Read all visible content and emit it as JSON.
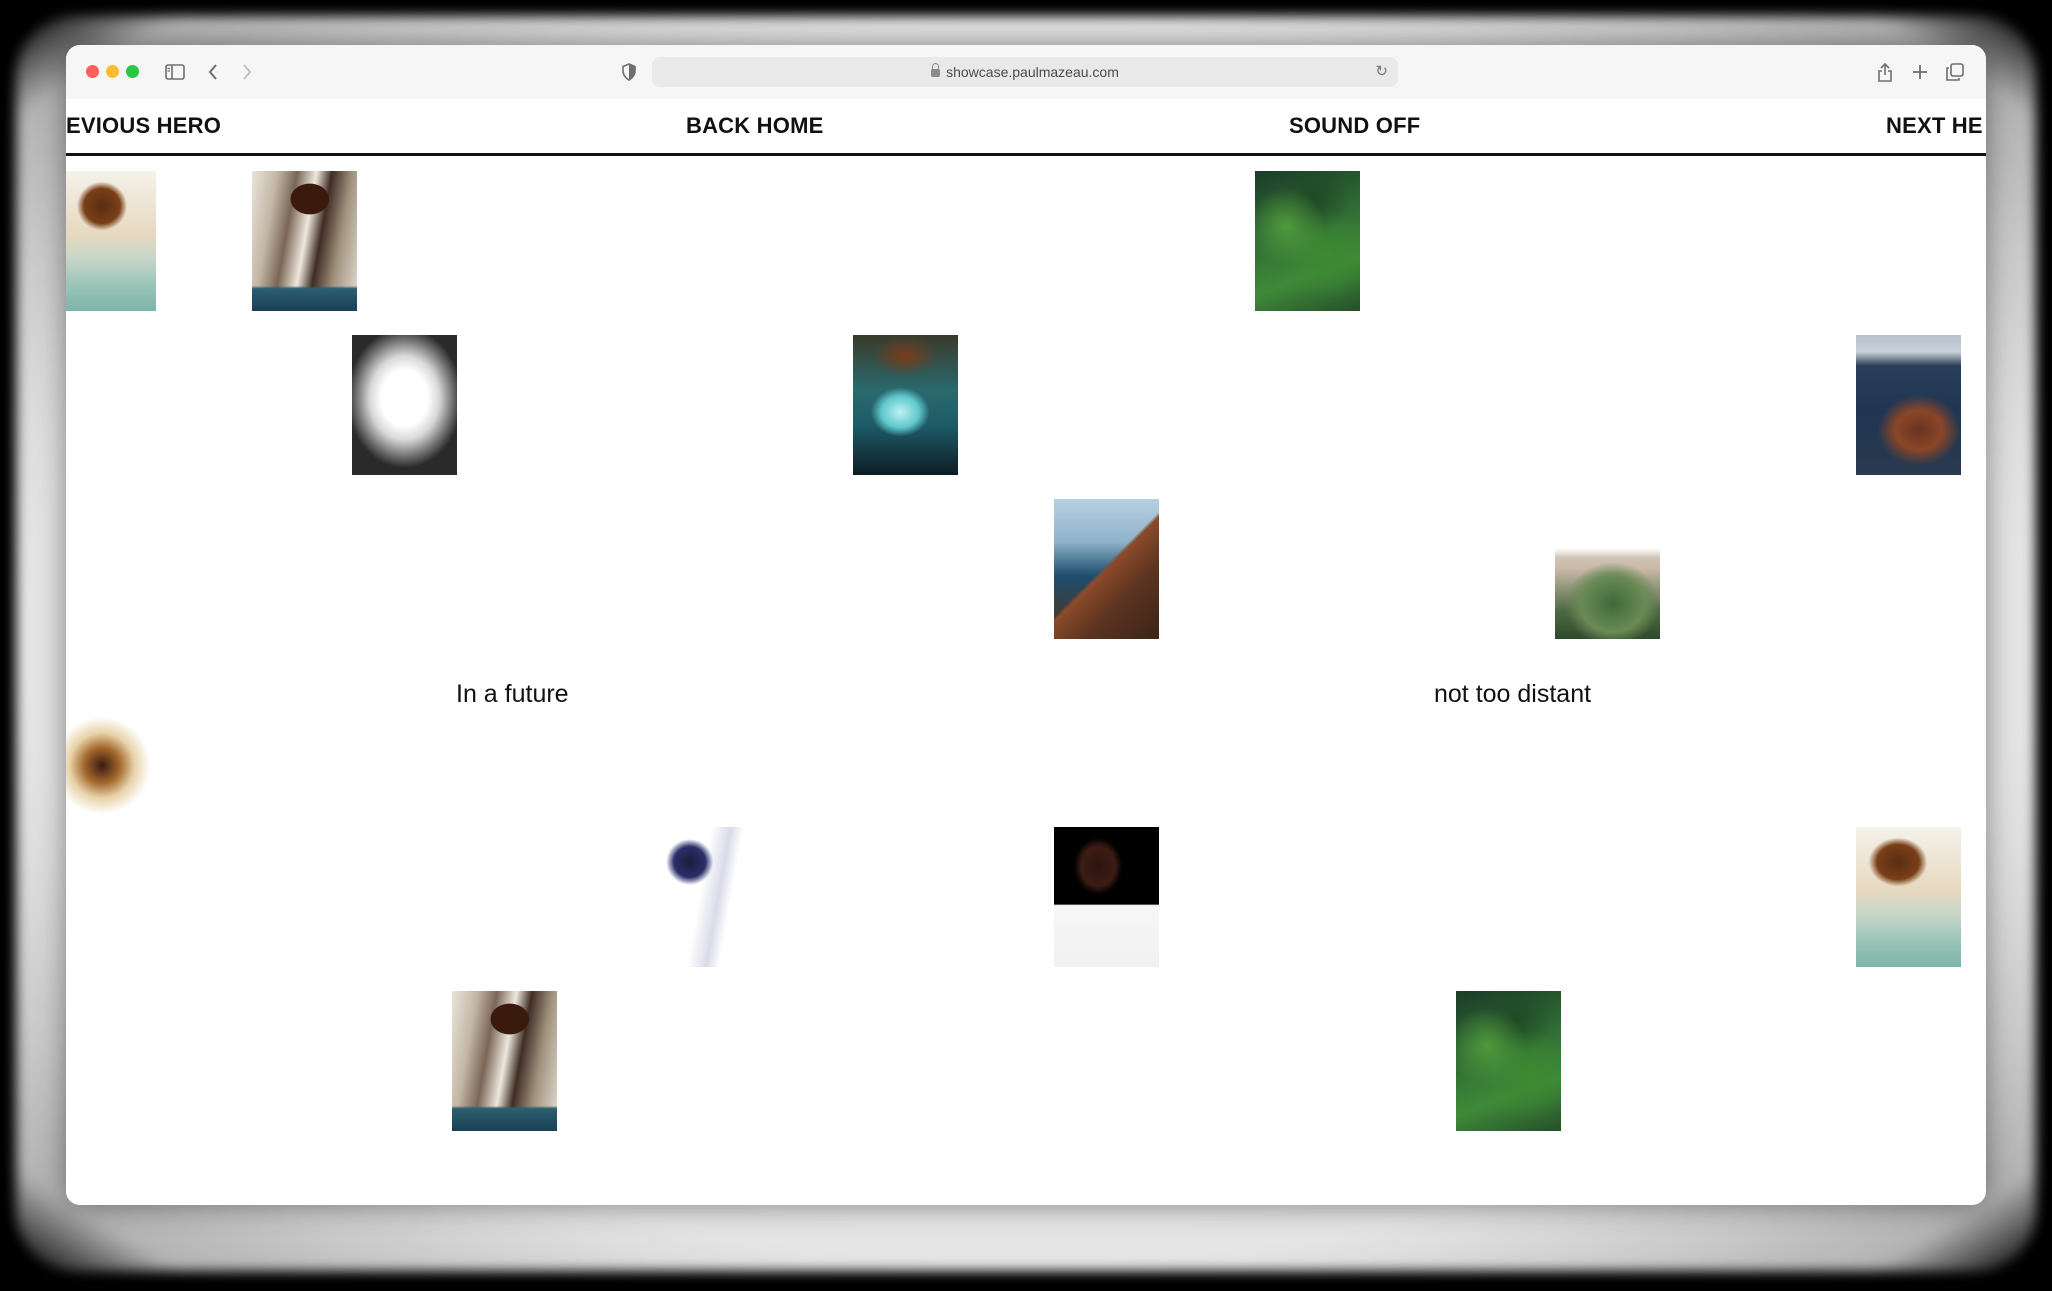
{
  "browser": {
    "url": "showcase.paulmazeau.com",
    "traffic_colors": {
      "close": "#ff5f57",
      "minimize": "#febc2e",
      "maximize": "#28c840"
    }
  },
  "nav": {
    "previous": "EVIOUS HERO",
    "home": "BACK HOME",
    "sound": "SOUND OFF",
    "next": "NEXT HE"
  },
  "captions": {
    "left": "In a future",
    "right": "not too distant"
  },
  "tiles": [
    {
      "id": "cliff-1",
      "theme": "cliff"
    },
    {
      "id": "cliff-2",
      "theme": "cliff"
    },
    {
      "id": "green-1",
      "theme": "green"
    },
    {
      "id": "glow-1",
      "theme": "glow"
    },
    {
      "id": "water-1",
      "theme": "water"
    },
    {
      "id": "coast-1",
      "theme": "coast"
    },
    {
      "id": "rocks-1",
      "theme": "rocks"
    },
    {
      "id": "hill-1",
      "theme": "hill"
    },
    {
      "id": "fade-1",
      "theme": "fade"
    },
    {
      "id": "man-1",
      "theme": "man"
    },
    {
      "id": "man-2",
      "theme": "man2"
    },
    {
      "id": "cliff-3",
      "theme": "cliff2"
    },
    {
      "id": "cliff-4",
      "theme": "cliff"
    },
    {
      "id": "green-2",
      "theme": "green"
    }
  ]
}
